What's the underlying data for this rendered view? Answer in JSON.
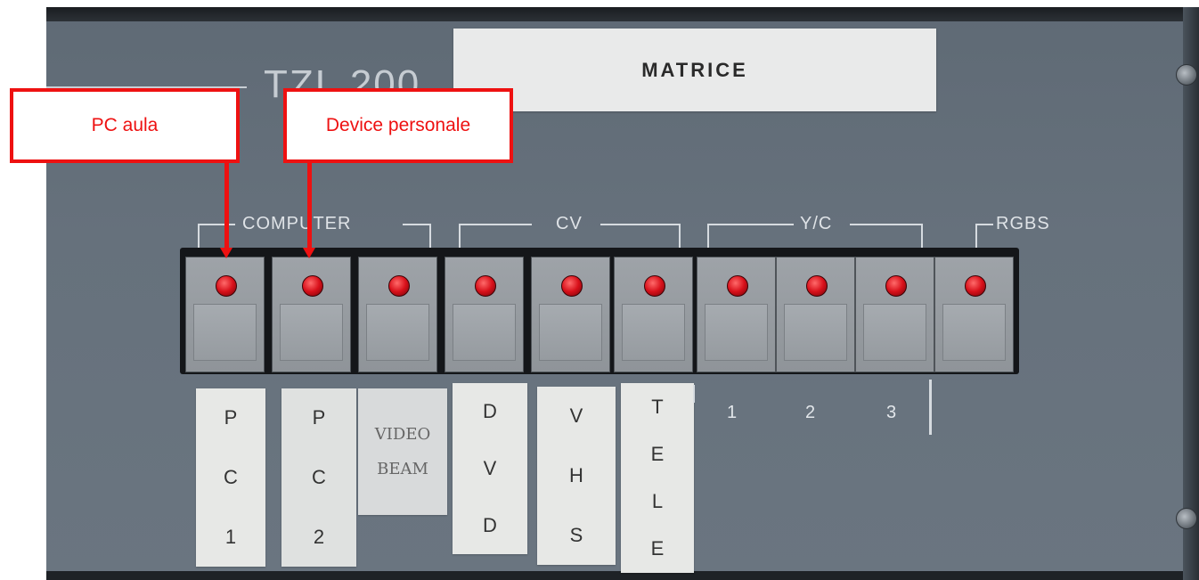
{
  "device": {
    "model": "TZL 200",
    "tape_label": "MATRICE"
  },
  "groups": {
    "computer": "COMPUTER",
    "cv": "CV",
    "yc": "Y/C",
    "rgbs": "RGBS"
  },
  "buttons": [
    {
      "led": "on"
    },
    {
      "led": "on"
    },
    {
      "led": "on"
    },
    {
      "led": "on"
    },
    {
      "led": "on"
    },
    {
      "led": "on"
    },
    {
      "led": "on"
    },
    {
      "led": "on"
    },
    {
      "led": "on"
    },
    {
      "led": "on"
    }
  ],
  "input_labels": {
    "pc1": [
      "P",
      "C",
      "1"
    ],
    "pc2": [
      "P",
      "C",
      "2"
    ],
    "video": [
      "VIDEO",
      "BEAM"
    ],
    "dvd": [
      "D",
      "V",
      "D"
    ],
    "vhs": [
      "V",
      "H",
      "S"
    ],
    "tele": [
      "T",
      "E",
      "L",
      "E"
    ],
    "yc_numbers": [
      "1",
      "2",
      "3"
    ]
  },
  "callouts": {
    "pc_aula": "PC aula",
    "device_personale": "Device personale"
  },
  "colors": {
    "annotation": "#ee1111",
    "panel": "#66717c",
    "led": "#d8101a"
  }
}
